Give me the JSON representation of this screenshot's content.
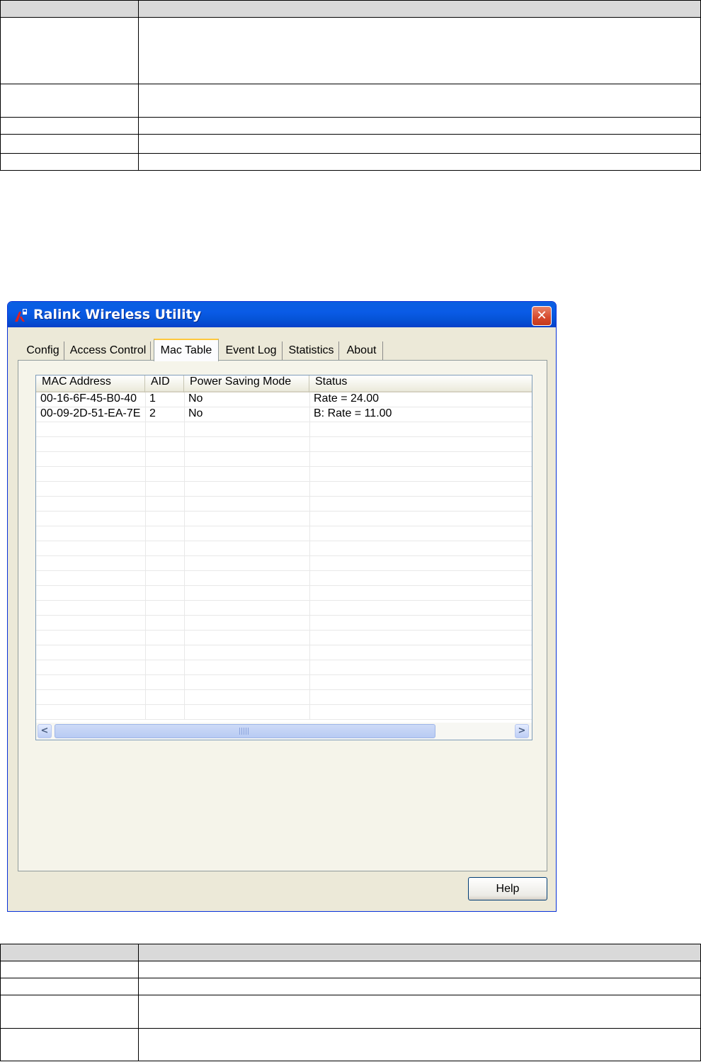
{
  "window": {
    "title": "Ralink Wireless Utility",
    "close_label": "✕"
  },
  "tabs": [
    {
      "label": "Config"
    },
    {
      "label": "Access Control"
    },
    {
      "label": "Mac Table",
      "active": true
    },
    {
      "label": "Event Log"
    },
    {
      "label": "Statistics"
    },
    {
      "label": "About"
    }
  ],
  "mac_table": {
    "columns": [
      "MAC Address",
      "AID",
      "Power Saving Mode",
      "Status"
    ],
    "rows": [
      [
        "00-16-6F-45-B0-40",
        "1",
        "No",
        "Rate = 24.00"
      ],
      [
        "00-09-2D-51-EA-7E",
        "2",
        "No",
        "B: Rate = 11.00"
      ]
    ]
  },
  "scrollbar": {
    "left_arrow": "<",
    "right_arrow": ">"
  },
  "help_button": "Help"
}
